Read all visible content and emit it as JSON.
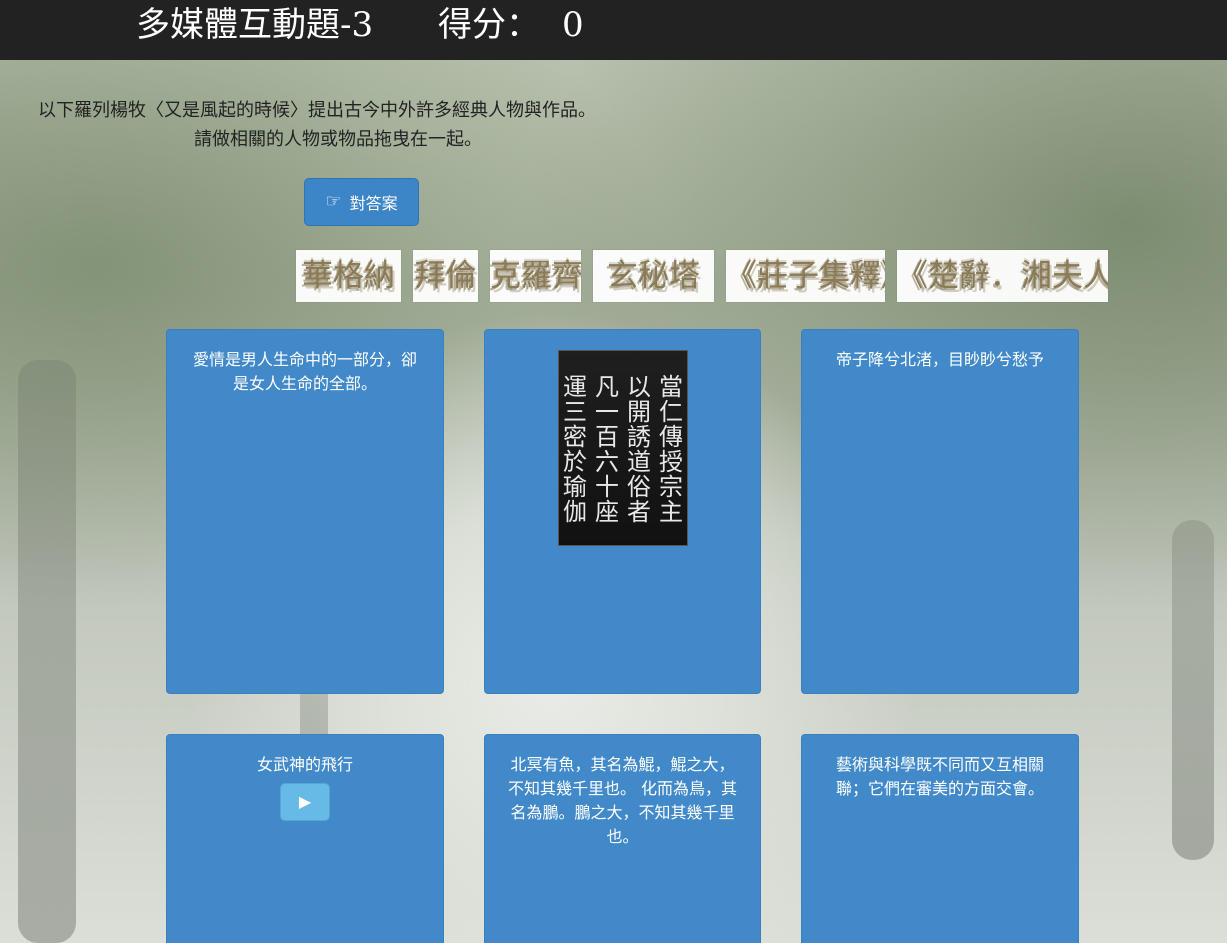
{
  "header": {
    "title": "多媒體互動題-3",
    "score_label": "得分：",
    "score_value": "0"
  },
  "instructions": {
    "line1": "以下羅列楊牧〈又是風起的時候〉提出古今中外許多經典人物與作品。",
    "line2": "請做相關的人物或物品拖曳在一起。"
  },
  "buttons": {
    "check_answer": "對答案",
    "check_icon": "pointing-hand-icon",
    "play_icon": "play-icon"
  },
  "draggable_tiles": [
    "華格納",
    "拜倫",
    "克羅齊",
    "玄秘塔",
    "《莊子集釋》",
    "《楚辭．湘夫人》"
  ],
  "cards": [
    {
      "text": "愛情是男人生命中的一部分，卻是女人生命的全部。"
    },
    {
      "image_columns": [
        "當仁傳授宗主",
        "以開誘道俗者",
        "凡一百六十座",
        "運三密於瑜伽"
      ]
    },
    {
      "text": "帝子降兮北渚，目眇眇兮愁予"
    },
    {
      "text": "女武神的飛行"
    },
    {
      "text": "北冥有魚，其名為鯤，鯤之大，不知其幾千里也。 化而為鳥，其名為鵬。鵬之大，不知其幾千里也。"
    },
    {
      "text": "藝術與科學既不同而又互相關聯；它們在審美的方面交會。"
    }
  ],
  "colors": {
    "header_bg": "#222222",
    "button_blue": "#3c86c7",
    "card_blue": "#4189c9",
    "play_button": "#67b9e6"
  }
}
